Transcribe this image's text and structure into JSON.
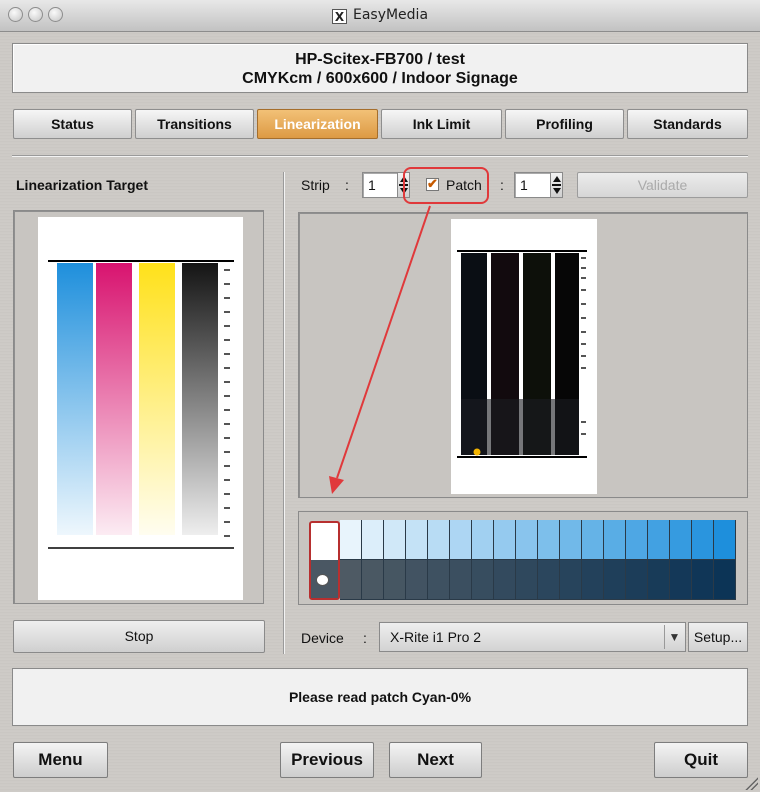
{
  "window": {
    "title": "EasyMedia"
  },
  "header": {
    "line1": "HP-Scitex-FB700 / test",
    "line2": "CMYKcm / 600x600 / Indoor Signage"
  },
  "tabs": [
    {
      "label": "Status",
      "active": false
    },
    {
      "label": "Transitions",
      "active": false
    },
    {
      "label": "Linearization",
      "active": true
    },
    {
      "label": "Ink Limit",
      "active": false
    },
    {
      "label": "Profiling",
      "active": false
    },
    {
      "label": "Standards",
      "active": false
    }
  ],
  "left": {
    "title": "Linearization Target",
    "stop_label": "Stop"
  },
  "controls": {
    "strip_label": "Strip",
    "colon": ":",
    "strip_value": "1",
    "patch_label": "Patch",
    "patch_checked": true,
    "patch_value": "1",
    "validate_label": "Validate"
  },
  "device": {
    "label": "Device",
    "colon": ":",
    "value": "X-Rite i1 Pro 2",
    "setup_label": "Setup..."
  },
  "status": {
    "message": "Please read patch Cyan-0%"
  },
  "buttons": {
    "menu": "Menu",
    "previous": "Previous",
    "next": "Next",
    "quit": "Quit"
  },
  "colors": {
    "accent_tab": "#e0a04e",
    "cyan": "#1e8fdc",
    "magenta": "#d8136f",
    "yellow": "#ffe11a",
    "black": "#141414",
    "highlight": "#e0393b"
  }
}
